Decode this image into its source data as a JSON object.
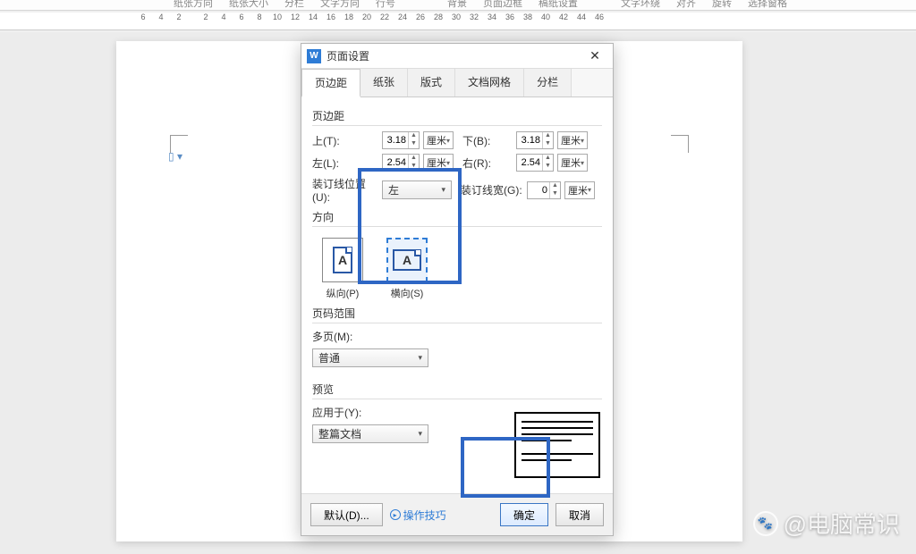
{
  "ribbon": {
    "items": [
      "纸张方向",
      "纸张大小",
      "分栏",
      "文字方向",
      "行号",
      "背景",
      "页面边框",
      "稿纸设置",
      "文字环绕",
      "对齐",
      "旋转",
      "选择窗格"
    ]
  },
  "ruler_left": [
    "6",
    "4",
    "2"
  ],
  "ruler_right": [
    "2",
    "4",
    "6",
    "8",
    "10",
    "12",
    "14",
    "16",
    "18",
    "20",
    "22",
    "24",
    "26",
    "28",
    "30",
    "32",
    "34",
    "36",
    "38",
    "40",
    "42",
    "44",
    "46"
  ],
  "dialog": {
    "title": "页面设置",
    "tabs": [
      "页边距",
      "纸张",
      "版式",
      "文档网格",
      "分栏"
    ],
    "active_tab": 0,
    "margins": {
      "section": "页边距",
      "top_label": "上(T):",
      "top_value": "3.18",
      "top_unit": "厘米",
      "bottom_label": "下(B):",
      "bottom_value": "3.18",
      "bottom_unit": "厘米",
      "left_label": "左(L):",
      "left_value": "2.54",
      "left_unit": "厘米",
      "right_label": "右(R):",
      "right_value": "2.54",
      "right_unit": "厘米",
      "gutter_pos_label": "装订线位置(U):",
      "gutter_pos_value": "左",
      "gutter_width_label": "装订线宽(G):",
      "gutter_width_value": "0",
      "gutter_width_unit": "厘米"
    },
    "orientation": {
      "section": "方向",
      "portrait_label": "纵向(P)",
      "landscape_label": "横向(S)",
      "selected": "landscape"
    },
    "page_range": {
      "section": "页码范围",
      "multi_label": "多页(M):",
      "multi_value": "普通"
    },
    "preview": {
      "section": "预览",
      "apply_label": "应用于(Y):",
      "apply_value": "整篇文档"
    },
    "buttons": {
      "default": "默认(D)...",
      "tips": "操作技巧",
      "ok": "确定",
      "cancel": "取消"
    }
  },
  "watermark": "@电脑常识"
}
